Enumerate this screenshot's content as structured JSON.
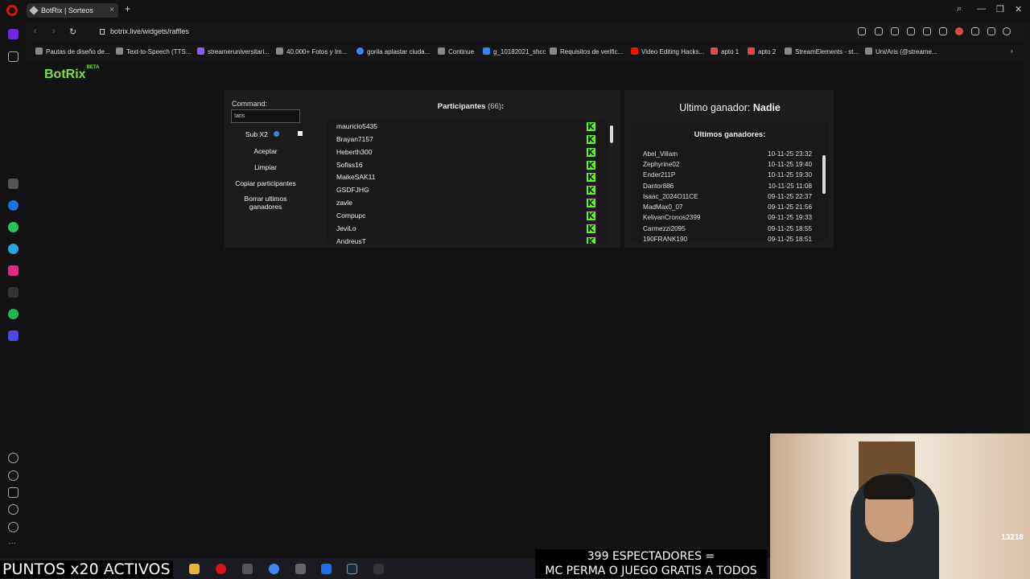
{
  "browser": {
    "tab_title": "BotRix | Sorteos",
    "url": "botrix.live/widgets/raffles",
    "bookmarks": [
      "Pautas de diseño de...",
      "Text-to-Speech (TTS...",
      "streameruniversitari...",
      "40.000+ Fotos y Im...",
      "gorila aplastar ciuda...",
      "Continue",
      "g_10182021_shcc",
      "Requisitos de verific...",
      "Video Editing Hacks...",
      "apto 1",
      "apto 2",
      "StreamElements - st...",
      "Uni/Aris (@streame..."
    ]
  },
  "brand": {
    "name": "BotRix",
    "badge": "BETA"
  },
  "controls": {
    "command_label": "Command:",
    "command_value": "!aris",
    "sub_label": "Sub X2",
    "accept": "Aceptar",
    "clear": "Limpiar",
    "copy": "Copiar participantes",
    "delete_line1": "Borrar ultimos",
    "delete_line2": "ganadores"
  },
  "participants": {
    "title": "Participantes",
    "count": "(66)",
    "colon": ":",
    "names": [
      "mauricio5435",
      "Brayan7157",
      "Heberth300",
      "Sofiss16",
      "MaikeSAK11",
      "GSDFJHG",
      "zavle",
      "Compupc",
      "JeviLo",
      "AndreusT"
    ]
  },
  "winner": {
    "label": "Ultimo ganador:",
    "name": "Nadie"
  },
  "recent": {
    "title": "Ultimos ganadores:",
    "rows": [
      {
        "name": "Abel_Villam",
        "date": "10-11-25 23:32"
      },
      {
        "name": "Zephyrine02",
        "date": "10-11-25 19:40"
      },
      {
        "name": "Ender211P",
        "date": "10-11-25 19:30"
      },
      {
        "name": "Dantor886",
        "date": "10-11-25 11:08"
      },
      {
        "name": "Isaac_2024O11CE",
        "date": "09-11-25 22:37"
      },
      {
        "name": "MadMax0_07",
        "date": "09-11-25 21:56"
      },
      {
        "name": "KelivanCronos2399",
        "date": "09-11-25 19:33"
      },
      {
        "name": "Carmezzi2095",
        "date": "09-11-25 18:55"
      },
      {
        "name": "190FRANK190",
        "date": "09-11-25 18:51"
      }
    ]
  },
  "overlay": {
    "left": "PUNTOS x20 ACTIVOS",
    "right_line1": "399 ESPECTADORES =",
    "right_line2": "MC PERMA O JUEGO GRATIS A TODOS",
    "cam_tag": "13218"
  },
  "colors": {
    "kick_green": "#53fc18",
    "brand_green": "#7ee03a",
    "background": "#141414"
  }
}
